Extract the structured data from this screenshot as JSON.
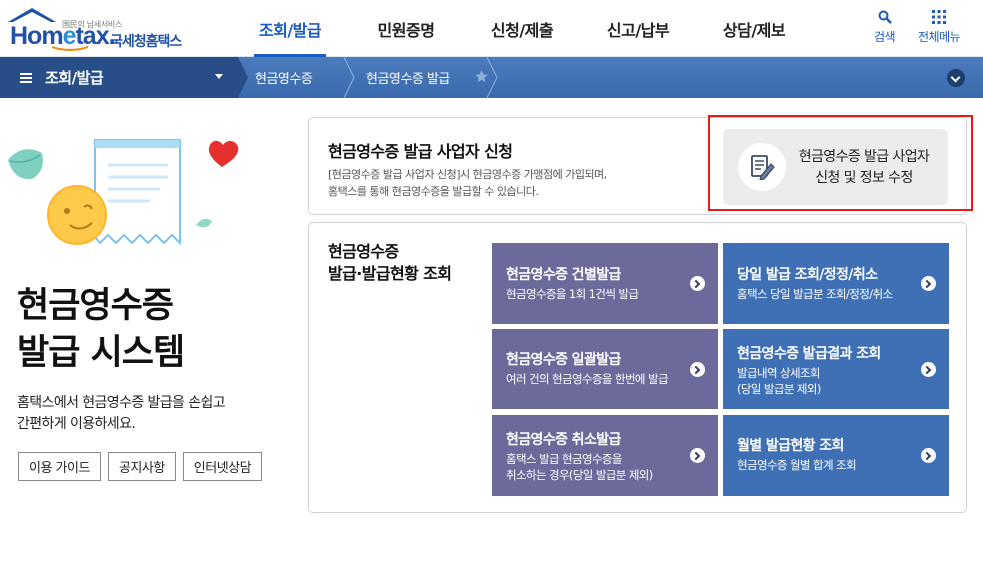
{
  "header": {
    "logo": {
      "tagline": "国民의 납세서비스",
      "brand_pre": "Hom",
      "brand_e": "e",
      "brand_post": "tax.",
      "brand_kr": "국세청홈택스"
    },
    "nav": [
      "조회/발급",
      "민원증명",
      "신청/제출",
      "신고/납부",
      "상담/제보"
    ],
    "active_index": 0,
    "search_label": "검색",
    "allmenu_label": "전체메뉴",
    "accent_color": "#1c5bbf"
  },
  "location": {
    "home": "조회/발급",
    "crumbs": [
      "현금영수증",
      "현금영수증 발급"
    ]
  },
  "intro": {
    "title_line1": "현금영수증",
    "title_line2": "발급 시스템",
    "desc_line1": "홈택스에서 현금영수증 발급을 손쉽고",
    "desc_line2": "간편하게 이용하세요.",
    "buttons": [
      "이용 가이드",
      "공지사항",
      "인터넷상담"
    ]
  },
  "register": {
    "title": "현금영수증 발급 사업자 신청",
    "desc_line1": "[현금영수증 발급 사업자 신청]시 현금영수증 가맹점에 가입되며,",
    "desc_line2": "홈택스를 통해 현금영수증을 발급할 수 있습니다.",
    "button_line1": "현금영수증 발급 사업자",
    "button_line2": "신청 및 정보 수정"
  },
  "issue": {
    "title_line1": "현금영수증",
    "title_line2": "발급·발급현황 조회",
    "tiles": [
      {
        "title": "현금영수증 건별발급",
        "desc1": "현금영수증을 1회 1건씩 발급",
        "desc2": ""
      },
      {
        "title": "당일 발급 조회/정정/취소",
        "desc1": "홈택스 당일 발급분 조회/정정/취소",
        "desc2": ""
      },
      {
        "title": "현금영수증 일괄발급",
        "desc1": "여러 건의 현금영수증을 한번에 발급",
        "desc2": ""
      },
      {
        "title": "현금영수증 발급결과 조회",
        "desc1": "발급내역 상세조회",
        "desc2": "(당일 발급분 제외)"
      },
      {
        "title": "현금영수증 취소발급",
        "desc1": "홈택스 발급 현금영수증을",
        "desc2": "취소하는 경우(당일 발급분 제외)"
      },
      {
        "title": "월별 발급현황 조회",
        "desc1": "현금영수증 월별 합계 조회",
        "desc2": ""
      }
    ],
    "colors": {
      "purple": "#6c6a9a",
      "blue": "#3f6fb5"
    }
  },
  "highlight_color": "#e31b1b"
}
